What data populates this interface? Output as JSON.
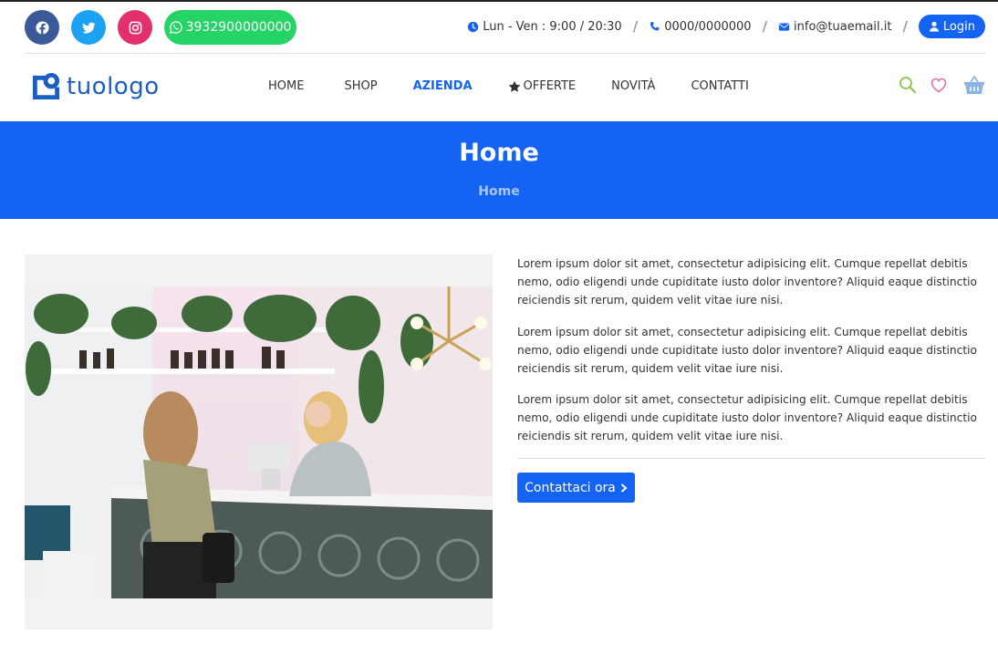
{
  "topbar": {
    "whatsapp": "3932900000000",
    "hours": "Lun - Ven : 9:00 / 20:30",
    "phone": "0000/0000000",
    "email": "info@tuaemail.it",
    "separator": "/",
    "login": "Login"
  },
  "logo": {
    "text": "tuologo"
  },
  "nav": {
    "items": [
      {
        "label": "HOME"
      },
      {
        "label": "SHOP"
      },
      {
        "label": "AZIENDA"
      },
      {
        "label": "OFFERTE"
      },
      {
        "label": "NOVITÀ"
      },
      {
        "label": "CONTATTI"
      }
    ],
    "active": "AZIENDA"
  },
  "icons": [
    "facebook-icon",
    "twitter-icon",
    "instagram-icon",
    "whatsapp-icon",
    "clock-icon",
    "phone-icon",
    "envelope-icon",
    "user-icon",
    "star-icon",
    "search-icon",
    "heart-icon",
    "basket-icon",
    "chevron-right-icon"
  ],
  "hero": {
    "title": "Home",
    "breadcrumb": "Home"
  },
  "content": {
    "paragraphs": [
      "Lorem ipsum dolor sit amet, consectetur adipisicing elit. Cumque repellat debitis nemo, odio eligendi unde cupiditate iusto dolor inventore? Aliquid eaque distinctio reiciendis sit rerum, quidem velit vitae iure nisi.",
      "Lorem ipsum dolor sit amet, consectetur adipisicing elit. Cumque repellat debitis nemo, odio eligendi unde cupiditate iusto dolor inventore? Aliquid eaque distinctio reiciendis sit rerum, quidem velit vitae iure nisi.",
      "Lorem ipsum dolor sit amet, consectetur adipisicing elit. Cumque repellat debitis nemo, odio eligendi unde cupiditate iusto dolor inventore? Aliquid eaque distinctio reiciendis sit rerum, quidem velit vitae iure nisi."
    ],
    "cta": "Contattaci ora"
  },
  "colors": {
    "primary": "#1463f3",
    "facebook": "#3b5998",
    "twitter": "#1da1f2",
    "instagram": "#e1306c",
    "whatsapp": "#25d366"
  }
}
